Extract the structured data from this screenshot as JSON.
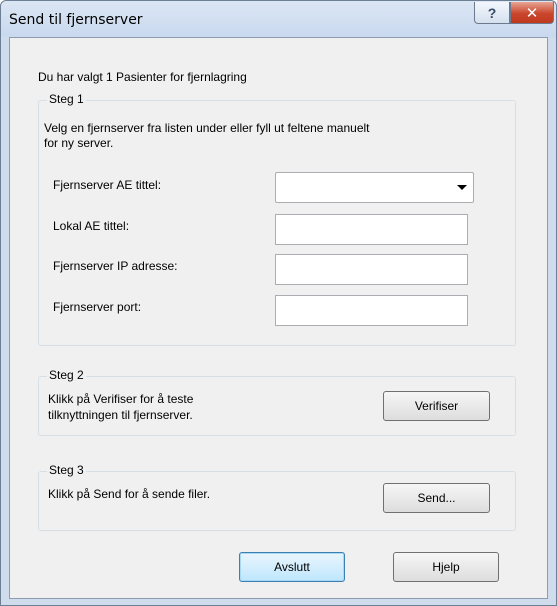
{
  "window": {
    "title": "Send til fjernserver",
    "help_glyph": "?",
    "close_glyph": "✕"
  },
  "intro": "Du har valgt 1 Pasienter for fjernlagring",
  "step1": {
    "legend": "Steg 1",
    "description_line1": "Velg en fjernserver fra listen under eller fyll ut feltene manuelt",
    "description_line2": "for ny server.",
    "fields": {
      "ae_title_label": "Fjernserver AE tittel:",
      "ae_title_value": "",
      "local_ae_label": "Lokal AE tittel:",
      "local_ae_value": "",
      "ip_label": "Fjernserver IP adresse:",
      "ip_value": "",
      "port_label": "Fjernserver port:",
      "port_value": ""
    }
  },
  "step2": {
    "legend": "Steg 2",
    "description_line1": "Klikk på Verifiser for å  teste",
    "description_line2": "tilknyttningen til fjernserver.",
    "button": "Verifiser"
  },
  "step3": {
    "legend": "Steg 3",
    "description": "Klikk på Send for å sende filer.",
    "button": "Send..."
  },
  "footer": {
    "exit_button": "Avslutt",
    "help_button": "Hjelp"
  }
}
